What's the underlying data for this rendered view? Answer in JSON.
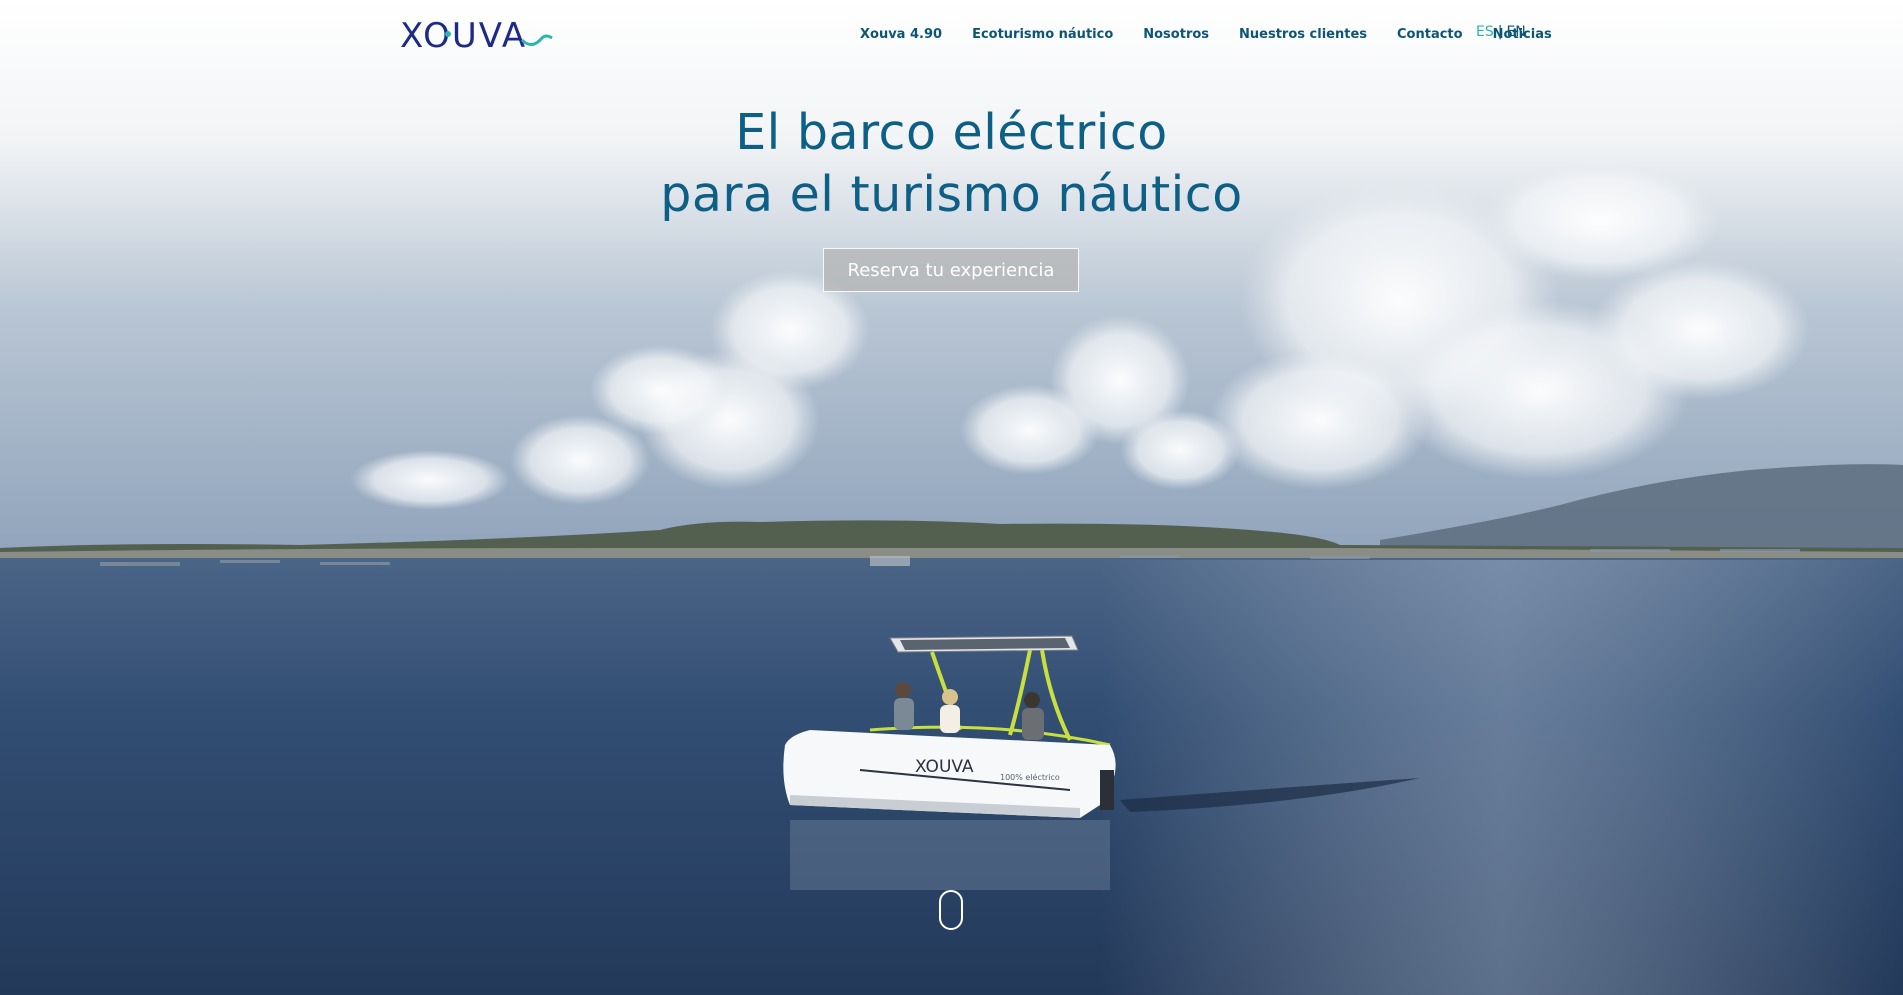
{
  "header": {
    "logo_text": "XOUVA",
    "nav": [
      {
        "label": "Xouva 4.90"
      },
      {
        "label": "Ecoturismo náutico"
      },
      {
        "label": "Nosotros"
      },
      {
        "label": "Nuestros clientes"
      },
      {
        "label": "Contacto"
      },
      {
        "label": "Noticias"
      }
    ],
    "lang": {
      "es": "ES",
      "separator": "|",
      "en": "EN",
      "active": "ES"
    }
  },
  "hero": {
    "title_line1": "El barco eléctrico",
    "title_line2": "para el turismo náutico",
    "cta_label": "Reserva tu experiencia",
    "boat_brand": "XOUVA",
    "boat_tagline": "100% eléctrico"
  },
  "colors": {
    "accent": "#2bb5ad",
    "brand_blue": "#0d5f86",
    "logo_navy": "#1e2a8a",
    "sea": "#2d4868"
  },
  "icons": {
    "scroll": "scroll-mouse-icon"
  }
}
